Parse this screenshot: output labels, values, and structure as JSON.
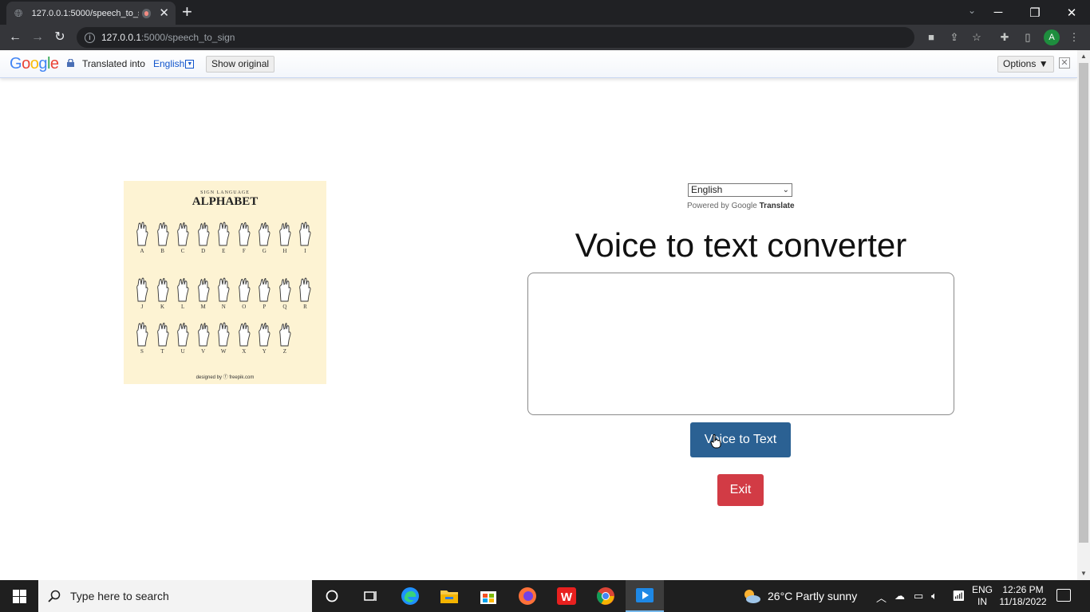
{
  "browser": {
    "tab_title": "127.0.0.1:5000/speech_to_sign",
    "url_host": "127.0.0.1",
    "url_path": ":5000/speech_to_sign",
    "profile_initial": "A"
  },
  "translate_bar": {
    "logo": "Google",
    "translated_into": "Translated into",
    "language": "English",
    "show_original": "Show original",
    "options": "Options ▼"
  },
  "page": {
    "sign_image": {
      "subtitle": "SIGN LANGUAGE",
      "title": "ALPHABET",
      "rows": [
        [
          "A",
          "B",
          "C",
          "D",
          "E",
          "F",
          "G",
          "H",
          "I"
        ],
        [
          "J",
          "K",
          "L",
          "M",
          "N",
          "O",
          "P",
          "Q",
          "R"
        ],
        [
          "S",
          "T",
          "U",
          "V",
          "W",
          "X",
          "Y",
          "Z"
        ]
      ],
      "credit": "designed by ⓕ freepik.com"
    },
    "language_select": "English",
    "powered_by": "Powered by",
    "powered_google": "Google",
    "powered_translate": "Translate",
    "heading": "Voice to text converter",
    "textbox_value": "",
    "voice_button": "Voice to Text",
    "exit_button": "Exit"
  },
  "taskbar": {
    "search_placeholder": "Type here to search",
    "weather": "26°C  Partly sunny",
    "lang_line1": "ENG",
    "lang_line2": "IN",
    "time": "12:26 PM",
    "date": "11/18/2022"
  },
  "colors": {
    "voice_button": "#2b6193",
    "exit_button": "#d23b45",
    "sign_card_bg": "#fdf3d3"
  }
}
